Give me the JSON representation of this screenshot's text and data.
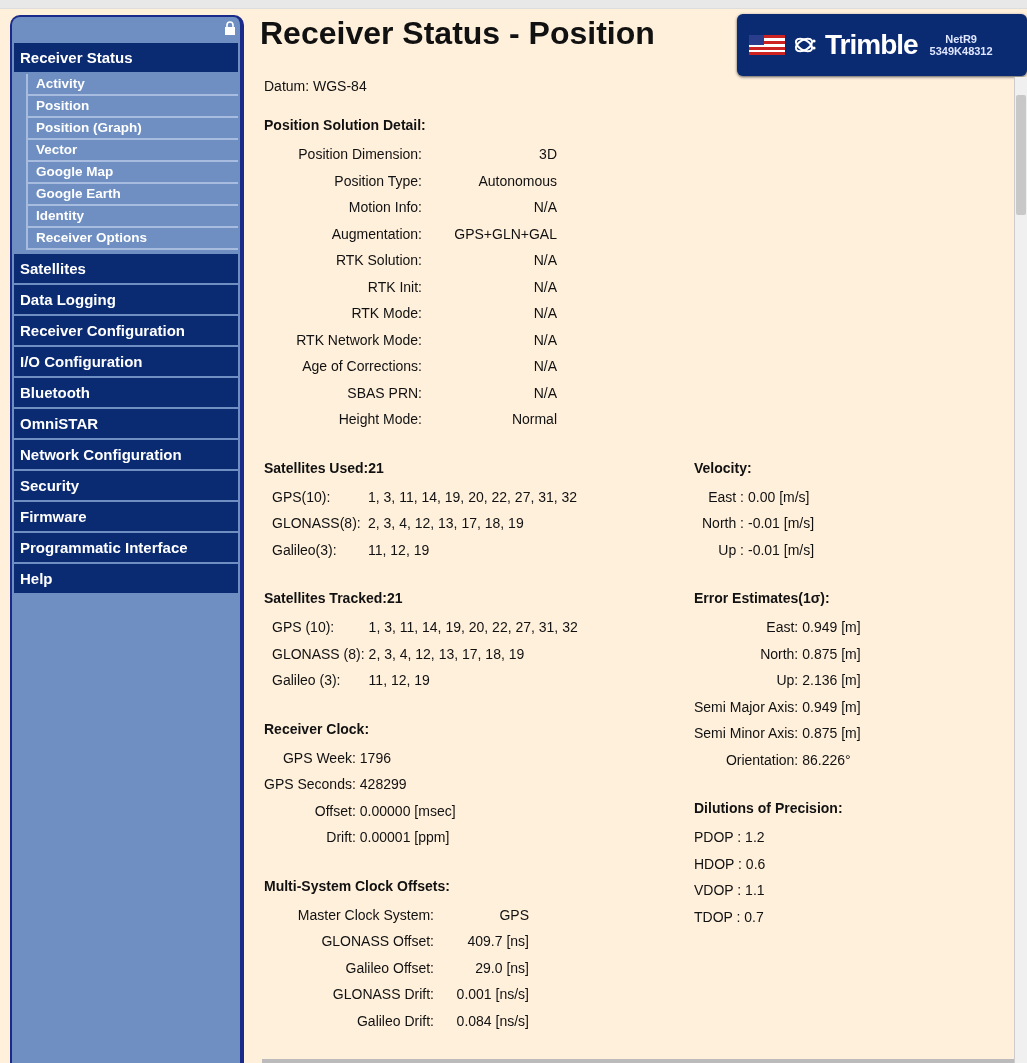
{
  "sidebar": {
    "groups": [
      {
        "label": "Receiver Status",
        "children": [
          {
            "label": "Activity"
          },
          {
            "label": "Position"
          },
          {
            "label": "Position (Graph)"
          },
          {
            "label": "Vector"
          },
          {
            "label": "Google Map"
          },
          {
            "label": "Google Earth"
          },
          {
            "label": "Identity"
          },
          {
            "label": "Receiver Options"
          }
        ]
      },
      {
        "label": "Satellites"
      },
      {
        "label": "Data Logging"
      },
      {
        "label": "Receiver Configuration"
      },
      {
        "label": "I/O Configuration"
      },
      {
        "label": "Bluetooth"
      },
      {
        "label": "OmniSTAR"
      },
      {
        "label": "Network Configuration"
      },
      {
        "label": "Security"
      },
      {
        "label": "Firmware"
      },
      {
        "label": "Programmatic Interface"
      },
      {
        "label": "Help"
      }
    ]
  },
  "page_title": "Receiver Status - Position",
  "logo": {
    "brand": "Trimble",
    "model": "NetR9",
    "serial": "5349K48312"
  },
  "datum": {
    "label": "Datum:",
    "value": "WGS-84"
  },
  "top_sections": [
    {
      "title": "Position Solution Detail:",
      "kind": "detail",
      "rows": [
        {
          "label": "Position Dimension:",
          "value": "3D"
        },
        {
          "label": "Position Type:",
          "value": "Autonomous"
        },
        {
          "label": "Motion Info:",
          "value": "N/A"
        },
        {
          "label": "Augmentation:",
          "value": "GPS+GLN+GAL"
        },
        {
          "label": "RTK Solution:",
          "value": "N/A"
        },
        {
          "label": "RTK Init:",
          "value": "N/A"
        },
        {
          "label": "RTK Mode:",
          "value": "N/A"
        },
        {
          "label": "RTK Network Mode:",
          "value": "N/A"
        },
        {
          "label": "Age of Corrections:",
          "value": "N/A"
        },
        {
          "label": "SBAS PRN:",
          "value": "N/A"
        },
        {
          "label": "Height Mode:",
          "value": "Normal"
        }
      ]
    }
  ],
  "left_sections": [
    {
      "title": "Satellites Used:21",
      "kind": "list",
      "rows": [
        {
          "label": "GPS(10):",
          "value": "1, 3, 11, 14, 19, 20, 22, 27, 31, 32"
        },
        {
          "label": "GLONASS(8):",
          "value": "2, 3, 4, 12, 13, 17, 18, 19"
        },
        {
          "label": "Galileo(3):",
          "value": "11, 12, 19"
        }
      ]
    },
    {
      "title": "Satellites Tracked:21",
      "kind": "list",
      "rows": [
        {
          "label": "GPS (10):",
          "value": "1, 3, 11, 14, 19, 20, 22, 27, 31, 32"
        },
        {
          "label": "GLONASS (8):",
          "value": "2, 3, 4, 12, 13, 17, 18, 19"
        },
        {
          "label": "Galileo (3):",
          "value": "11, 12, 19"
        }
      ]
    },
    {
      "title": "Receiver Clock:",
      "kind": "clock",
      "rows": [
        {
          "label": "GPS Week:",
          "value": "1796"
        },
        {
          "label": "GPS Seconds:",
          "value": "428299"
        },
        {
          "label": "Offset:",
          "value": "0.00000 [msec]"
        },
        {
          "label": "Drift:",
          "value": "0.00001  [ppm]"
        }
      ]
    },
    {
      "title": "Multi-System Clock Offsets:",
      "kind": "offsets",
      "rows": [
        {
          "label": "Master Clock System:",
          "value": "GPS"
        },
        {
          "label": "GLONASS Offset:",
          "value": "409.7 [ns]"
        },
        {
          "label": "Galileo Offset:",
          "value": "29.0 [ns]"
        },
        {
          "label": "GLONASS Drift:",
          "value": "0.001 [ns/s]"
        },
        {
          "label": "Galileo Drift:",
          "value": "0.084 [ns/s]"
        }
      ]
    }
  ],
  "right_sections": [
    {
      "title": "Velocity:",
      "kind": "velocity",
      "rows": [
        {
          "label": "East :",
          "value": "0.00 [m/s]"
        },
        {
          "label": "North :",
          "value": "-0.01 [m/s]"
        },
        {
          "label": "Up :",
          "value": "-0.01 [m/s]"
        }
      ]
    },
    {
      "title": "Error Estimates(1σ):",
      "kind": "clock",
      "rows": [
        {
          "label": "East:",
          "value": "0.949 [m]"
        },
        {
          "label": "North:",
          "value": "0.875 [m]"
        },
        {
          "label": "Up:",
          "value": "2.136 [m]"
        },
        {
          "label": "Semi Major Axis:",
          "value": "0.949 [m]"
        },
        {
          "label": "Semi Minor Axis:",
          "value": "0.875 [m]"
        },
        {
          "label": "Orientation:",
          "value": "86.226°"
        }
      ]
    },
    {
      "title": "Dilutions of Precision:",
      "kind": "lines",
      "rows": [
        {
          "value": "PDOP : 1.2"
        },
        {
          "value": "HDOP : 0.6"
        },
        {
          "value": "VDOP : 1.1"
        },
        {
          "value": "TDOP : 0.7"
        }
      ]
    }
  ]
}
